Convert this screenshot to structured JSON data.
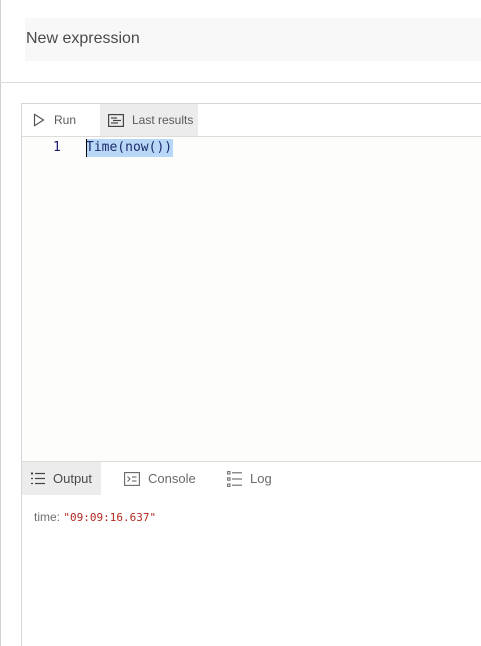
{
  "header": {
    "title": "New expression"
  },
  "toolbar": {
    "run_label": "Run",
    "run_icon": "play-icon",
    "last_results_label": "Last results",
    "last_results_icon": "results-icon"
  },
  "editor": {
    "line_numbers": [
      "1"
    ],
    "lines": [
      "Time(now())"
    ],
    "selection_color": "#b9d7f7"
  },
  "output_tabs": {
    "tabs": [
      {
        "label": "Output",
        "icon": "list-icon",
        "active": true
      },
      {
        "label": "Console",
        "icon": "console-icon",
        "active": false
      },
      {
        "label": "Log",
        "icon": "log-icon",
        "active": false
      }
    ]
  },
  "output": {
    "key": "time:",
    "value": "\"09:09:16.637\"",
    "value_color": "#b3281e"
  }
}
